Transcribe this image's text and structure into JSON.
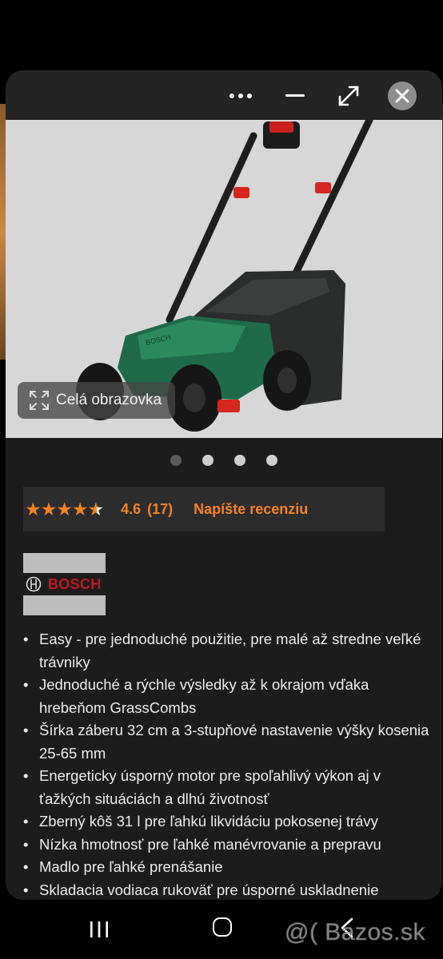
{
  "window": {
    "controls": {
      "more": "more-options",
      "minimize": "minimize",
      "maximize": "maximize",
      "close": "close"
    }
  },
  "gallery": {
    "fullscreen_label": "Celá obrazovka",
    "page_count": 4,
    "active_index": 0,
    "dot_active_color": "#5a5a5a",
    "dot_inactive_color": "#cfcfcf"
  },
  "rating": {
    "stars": 4.6,
    "value": "4.6",
    "count": "(17)",
    "review_link": "Napíšte recenziu",
    "accent_color": "#f58220"
  },
  "brand": {
    "name": "BOSCH",
    "color": "#c4161c"
  },
  "features": [
    "Easy - pre jednoduché použitie, pre malé až stredne veľké trávniky",
    "Jednoduché a rýchle výsledky až k okrajom vďaka hrebeňom GrassCombs",
    "Šírka záberu 32 cm a 3-stupňové nastavenie výšky kosenia 25-65 mm",
    "Energeticky úsporný motor pre spoľahlivý výkon aj v ťažkých situáciách a dlhú životnosť",
    "Zberný kôš 31 l pre ľahkú likvidáciu pokosenej trávy",
    "Nízka hmotnosť pre ľahké manévrovanie a prepravu",
    "Madlo pre ľahké prenášanie",
    "Skladacia vodiaca rukoväť pre úsporné uskladnenie"
  ],
  "watermark": "@( Bazos.sk"
}
